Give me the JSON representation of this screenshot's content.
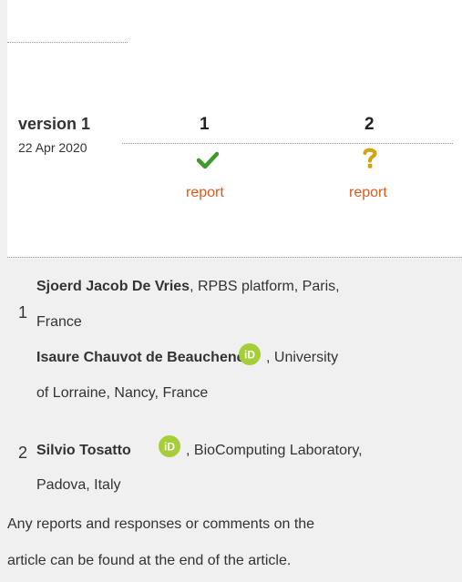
{
  "review": {
    "version_label": "version 1",
    "date": "22 Apr 2020",
    "columns": [
      "1",
      "2"
    ],
    "reports": [
      {
        "status_icon": "checkmark-icon",
        "label": "report"
      },
      {
        "status_icon": "question-mark-icon",
        "label": "report"
      }
    ],
    "approved_color": "#3c9b2a",
    "unsure_color": "#d4a30a",
    "report_color": "#e05a1e"
  },
  "authors": [
    {
      "number": "1",
      "name": "Sjoerd Jacob De Vries",
      "affiliation_l1": ", RPBS platform, Paris,",
      "affiliation_l2": "France"
    },
    {
      "number": "",
      "name": "Isaure Chauvot de Beauchene",
      "has_orcid": true,
      "affiliation_l1": ", University",
      "affiliation_l2": "of Lorraine, Nancy, France"
    },
    {
      "number": "2",
      "name": "Silvio Tosatto",
      "has_orcid": true,
      "affiliation_l1": ", BioComputing Laboratory,",
      "affiliation_l2": "Padova, Italy"
    }
  ],
  "orcid_icon_text": "iD",
  "orcid_color": "#a6ce39",
  "footer_note_l1": "Any reports and responses or comments on the",
  "footer_note_l2": "article can be found at the end of the article."
}
